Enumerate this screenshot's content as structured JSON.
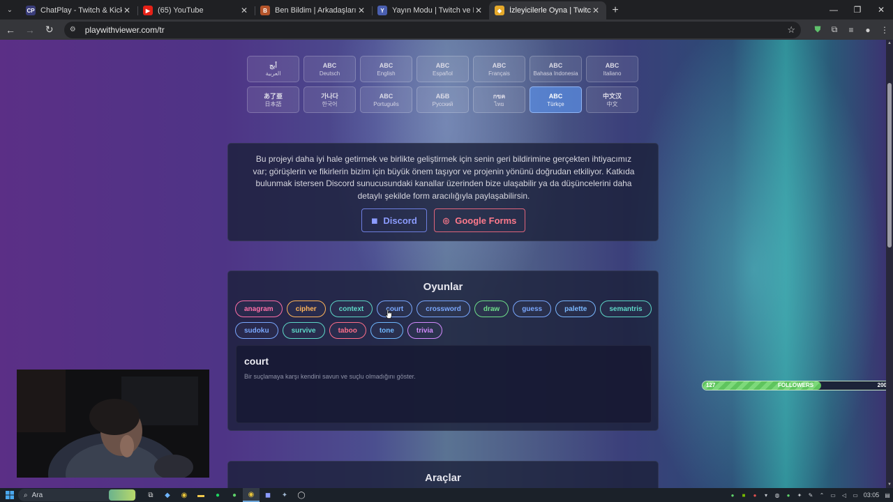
{
  "browser": {
    "tabs": [
      {
        "title": "ChatPlay - Twitch & Kick İzleyici",
        "favicon": "CP",
        "active": false,
        "fav_color": "#3a3d7a"
      },
      {
        "title": "(65) YouTube",
        "favicon": "▶",
        "active": false,
        "fav_color": "#e62117"
      },
      {
        "title": "Ben Bildim | Arkadaşlarınla Onl",
        "favicon": "B",
        "active": false,
        "fav_color": "#b5542a"
      },
      {
        "title": "Yayın Modu | Twitch ve Kick ile",
        "favicon": "Y",
        "active": false,
        "fav_color": "#4a5fb0"
      },
      {
        "title": "İzleyicilerle Oyna | Twitch, Kick,",
        "favicon": "◆",
        "active": true,
        "fav_color": "#e6a92a"
      }
    ],
    "new_tab": "+",
    "url": "playwithviewer.com/tr"
  },
  "languages": [
    {
      "glyph": "أبج",
      "name": "العربية",
      "active": false
    },
    {
      "glyph": "ABC",
      "name": "Deutsch",
      "active": false
    },
    {
      "glyph": "ABC",
      "name": "English",
      "active": false
    },
    {
      "glyph": "ABC",
      "name": "Español",
      "active": false
    },
    {
      "glyph": "ABC",
      "name": "Français",
      "active": false
    },
    {
      "glyph": "ABC",
      "name": "Bahasa Indonesia",
      "active": false
    },
    {
      "glyph": "ABC",
      "name": "Italiano",
      "active": false
    },
    {
      "glyph": "あ了亜",
      "name": "日本語",
      "active": false
    },
    {
      "glyph": "가나다",
      "name": "한국어",
      "active": false
    },
    {
      "glyph": "ABC",
      "name": "Português",
      "active": false
    },
    {
      "glyph": "АБВ",
      "name": "Русский",
      "active": false
    },
    {
      "glyph": "กขค",
      "name": "ไทย",
      "active": false
    },
    {
      "glyph": "ABC",
      "name": "Türkçe",
      "active": true
    },
    {
      "glyph": "中文汉",
      "name": "中文",
      "active": false
    }
  ],
  "feedback": {
    "text": "Bu projeyi daha iyi hale getirmek ve birlikte geliştirmek için senin geri bildirimine gerçekten ihtiyacımız var; görüşlerin ve fikirlerin bizim için büyük önem taşıyor ve projenin yönünü doğrudan etkiliyor. Katkıda bulunmak istersen Discord sunucusundaki kanallar üzerinden bize ulaşabilir ya da düşüncelerini daha detaylı şekilde form aracılığıyla paylaşabilirsin.",
    "discord_label": "Discord",
    "forms_label": "Google Forms",
    "discord_color": "#8c9cff",
    "forms_color": "#ff7a8c"
  },
  "games": {
    "title": "Oyunlar",
    "items": [
      {
        "label": "anagram",
        "color": "#ff6fa8"
      },
      {
        "label": "cipher",
        "color": "#ffb45a"
      },
      {
        "label": "context",
        "color": "#5ed8c8"
      },
      {
        "label": "court",
        "color": "#7aa8ff"
      },
      {
        "label": "crossword",
        "color": "#7aa8ff"
      },
      {
        "label": "draw",
        "color": "#6fe08a"
      },
      {
        "label": "guess",
        "color": "#7aa8ff"
      },
      {
        "label": "palette",
        "color": "#7ab8ff"
      },
      {
        "label": "semantris",
        "color": "#5ed8c8"
      },
      {
        "label": "sudoku",
        "color": "#7aa8ff"
      },
      {
        "label": "survive",
        "color": "#5ed8c8"
      },
      {
        "label": "taboo",
        "color": "#ff6f8a"
      },
      {
        "label": "tone",
        "color": "#6fb8ff"
      },
      {
        "label": "trivia",
        "color": "#d38bff"
      }
    ],
    "selected": {
      "name": "court",
      "description": "Bir suçlamaya karşı kendini savun ve suçlu olmadığını göster."
    }
  },
  "tools": {
    "title": "Araçlar"
  },
  "followers": {
    "current": "127",
    "label": "FOLLOWERS",
    "goal": "200",
    "progress": 0.635
  },
  "taskbar": {
    "search_placeholder": "Ara",
    "clock": "03:05"
  }
}
